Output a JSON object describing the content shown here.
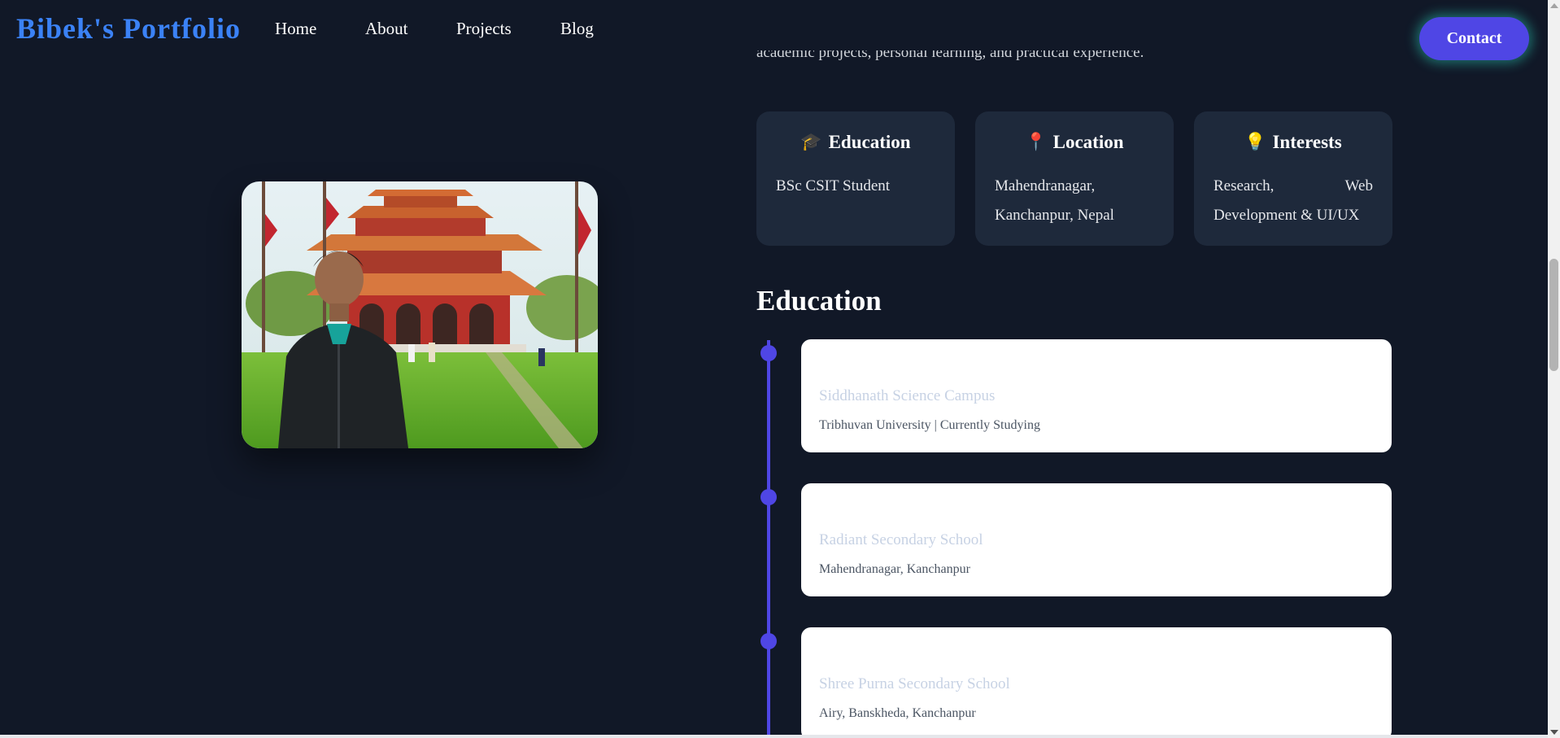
{
  "nav": {
    "brand": "Bibek's Portfolio",
    "links": [
      "Home",
      "About",
      "Projects",
      "Blog"
    ],
    "contact_label": "Contact"
  },
  "intro": {
    "tail_text": "academic projects, personal learning, and practical experience."
  },
  "photo": {
    "alt": "Bibek standing in front of a pagoda-style temple"
  },
  "info_cards": [
    {
      "icon": "graduation-cap-icon",
      "emoji": "🎓",
      "title": "Education",
      "body": "BSc CSIT Student"
    },
    {
      "icon": "pin-icon",
      "emoji": "📍",
      "title": "Location",
      "body": "Mahendranagar, Kanchanpur, Nepal"
    },
    {
      "icon": "lightbulb-icon",
      "emoji": "💡",
      "title": "Interests",
      "body": "Research, Web Development & UI/UX"
    }
  ],
  "education": {
    "title": "Education",
    "items": [
      {
        "school": "Siddhanath Science Campus",
        "detail": "Tribhuvan University | Currently Studying"
      },
      {
        "school": "Radiant Secondary School",
        "detail": "Mahendranagar, Kanchanpur"
      },
      {
        "school": "Shree Purna Secondary School",
        "detail": "Airy, Banskheda, Kanchanpur"
      }
    ]
  },
  "colors": {
    "background": "#111827",
    "brand": "#3b82f6",
    "accent": "#4f46e5",
    "card": "#1e293b"
  }
}
